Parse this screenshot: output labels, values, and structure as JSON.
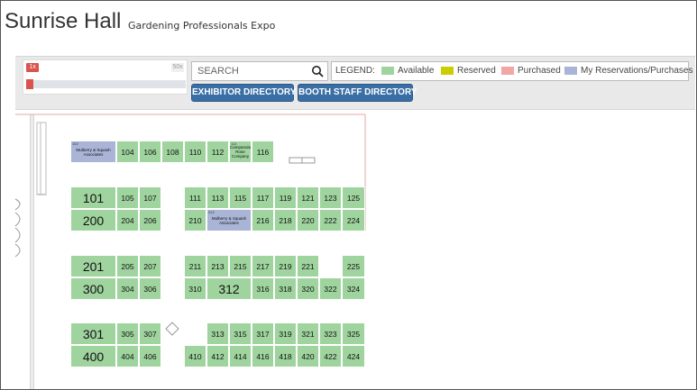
{
  "header": {
    "title": "Sunrise Hall",
    "subtitle": "Gardening Professionals Expo"
  },
  "zoom": {
    "min_label": "1x",
    "max_label": "50x",
    "level": 0
  },
  "search": {
    "placeholder": "SEARCH"
  },
  "legend": {
    "label": "LEGEND:",
    "items": [
      {
        "label": "Available",
        "color": "#9fd49f"
      },
      {
        "label": "Reserved",
        "color": "#cccc00"
      },
      {
        "label": "Purchased",
        "color": "#f2a6a6"
      },
      {
        "label": "My Reservations/Purchases",
        "color": "#a9b4d6"
      }
    ]
  },
  "buttons": {
    "exhibitor_directory": "EXHIBITOR DIRECTORY",
    "booth_staff_directory": "BOOTH STAFF DIRECTORY"
  },
  "booths": {
    "b102_small": "102",
    "b102_name": "Mulberry & Squash Associates",
    "b104": "104",
    "b106": "106",
    "b108": "108",
    "b110": "110",
    "b112": "112",
    "b114_small": "114",
    "b114_name": "Campanula Rose Company",
    "b116": "116",
    "b101": "101",
    "b105": "105",
    "b107": "107",
    "b111": "111",
    "b113": "113",
    "b115": "115",
    "b117": "117",
    "b119": "119",
    "b121": "121",
    "b123": "123",
    "b125": "125",
    "b200": "200",
    "b204": "204",
    "b206": "206",
    "b210": "210",
    "b212_small": "212",
    "b212_name": "Mulberry & Squash Associates",
    "b216": "216",
    "b218": "218",
    "b220": "220",
    "b222": "222",
    "b224": "224",
    "b201": "201",
    "b205": "205",
    "b207": "207",
    "b211": "211",
    "b213": "213",
    "b215": "215",
    "b217": "217",
    "b219": "219",
    "b221": "221",
    "b225": "225",
    "b300": "300",
    "b304": "304",
    "b306": "306",
    "b310": "310",
    "b312": "312",
    "b316": "316",
    "b318": "318",
    "b320": "320",
    "b322": "322",
    "b324": "324",
    "b301": "301",
    "b305": "305",
    "b307": "307",
    "b313": "313",
    "b315": "315",
    "b317": "317",
    "b319": "319",
    "b321": "321",
    "b323": "323",
    "b325": "325",
    "b400": "400",
    "b404": "404",
    "b406": "406",
    "b410": "410",
    "b412": "412",
    "b414": "414",
    "b416": "416",
    "b418": "418",
    "b420": "420",
    "b422": "422",
    "b424": "424"
  }
}
